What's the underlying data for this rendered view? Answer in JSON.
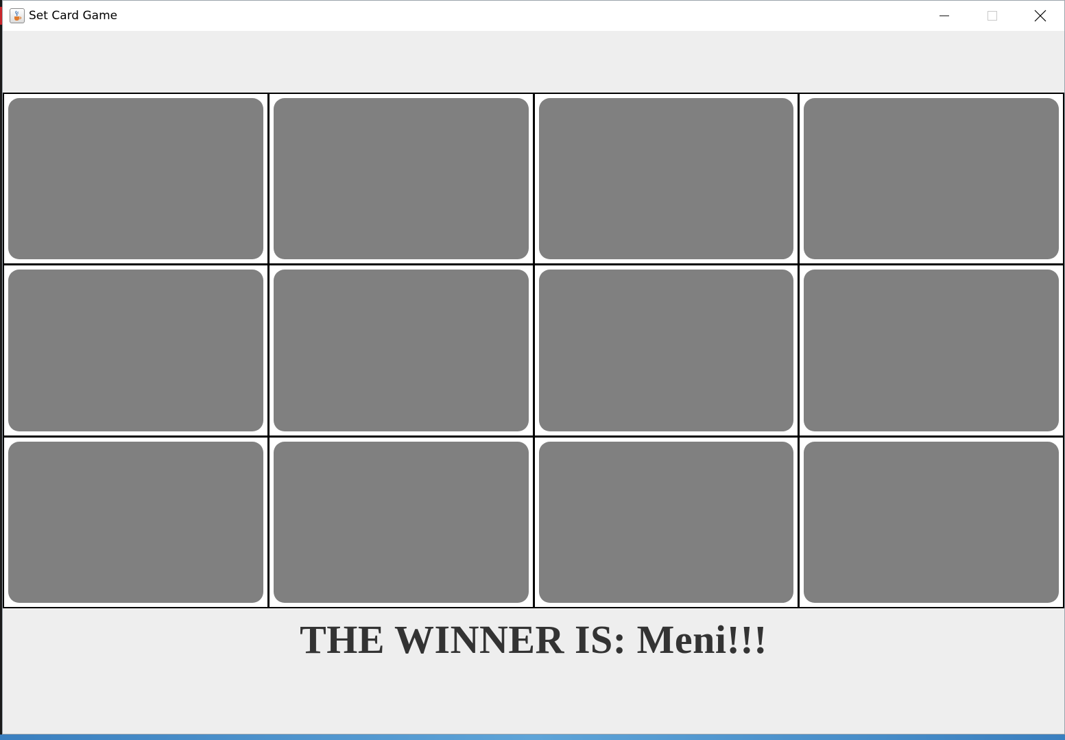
{
  "window": {
    "title": "Set Card Game",
    "icon": "java-cup-icon"
  },
  "controls": {
    "minimize": "minimize-icon",
    "maximize": "maximize-icon",
    "close": "close-icon"
  },
  "board": {
    "rows": 3,
    "columns": 4,
    "card_color": "#808080"
  },
  "status": {
    "winner_text": "THE WINNER IS: Meni!!!"
  }
}
